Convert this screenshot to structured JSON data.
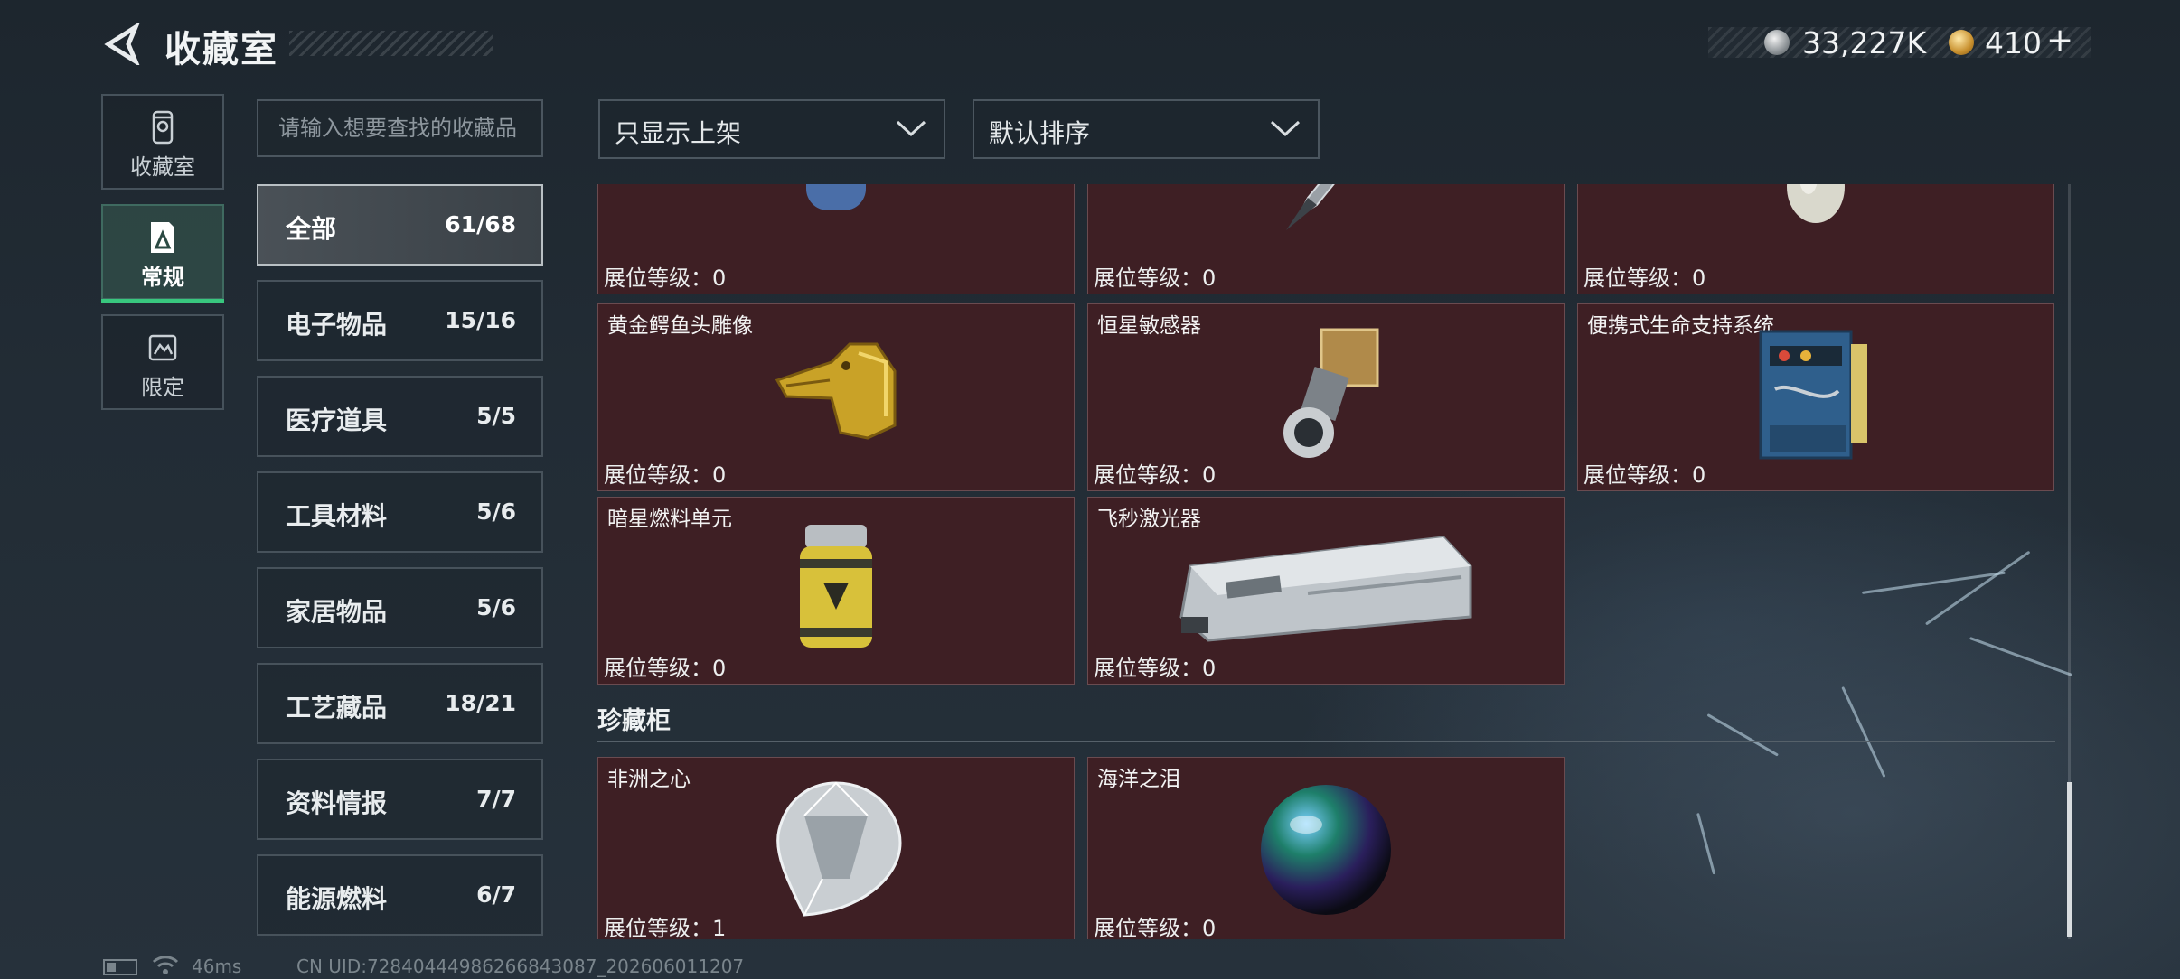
{
  "header": {
    "title": "收藏室",
    "currency_1": "33,227K",
    "currency_2": "410",
    "currency_2_add": "+"
  },
  "nav": [
    {
      "label": "收藏室"
    },
    {
      "label": "常规"
    },
    {
      "label": "限定"
    }
  ],
  "search": {
    "placeholder": "请输入想要查找的收藏品"
  },
  "filters": {
    "shelf_filter": "只显示上架",
    "sort": "默认排序"
  },
  "categories": [
    {
      "name": "全部",
      "count": "61/68"
    },
    {
      "name": "电子物品",
      "count": "15/16"
    },
    {
      "name": "医疗道具",
      "count": "5/5"
    },
    {
      "name": "工具材料",
      "count": "5/6"
    },
    {
      "name": "家居物品",
      "count": "5/6"
    },
    {
      "name": "工艺藏品",
      "count": "18/21"
    },
    {
      "name": "资料情报",
      "count": "7/7"
    },
    {
      "name": "能源燃料",
      "count": "6/7"
    }
  ],
  "items": [
    {
      "name": "",
      "level": "展位等级：0",
      "icon": "gas-canister-icon"
    },
    {
      "name": "",
      "level": "展位等级：0",
      "icon": "fountain-pen-icon"
    },
    {
      "name": "",
      "level": "展位等级：0",
      "icon": "porcelain-vase-icon"
    },
    {
      "name": "黄金鳄鱼头雕像",
      "level": "展位等级：0",
      "icon": "golden-crocodile-head-icon"
    },
    {
      "name": "恒星敏感器",
      "level": "展位等级：0",
      "icon": "star-sensor-icon"
    },
    {
      "name": "便携式生命支持系统",
      "level": "展位等级：0",
      "icon": "life-support-system-icon"
    },
    {
      "name": "暗星燃料单元",
      "level": "展位等级：0",
      "icon": "fuel-cell-icon"
    },
    {
      "name": "飞秒激光器",
      "level": "展位等级：0",
      "icon": "femtosecond-laser-icon"
    }
  ],
  "treasure_section": {
    "title": "珍藏柜",
    "items": [
      {
        "name": "非洲之心",
        "level": "展位等级：1",
        "icon": "diamond-icon"
      },
      {
        "name": "海洋之泪",
        "level": "展位等级：0",
        "icon": "pearl-icon"
      }
    ]
  },
  "status_bar": {
    "ping": "46ms",
    "uid": "CN UID:72840444986266843087_202606011207"
  },
  "colors": {
    "card_bg": "#3e1f24",
    "active_nav_underline": "#38c77e",
    "page_bg": "#222c35"
  }
}
